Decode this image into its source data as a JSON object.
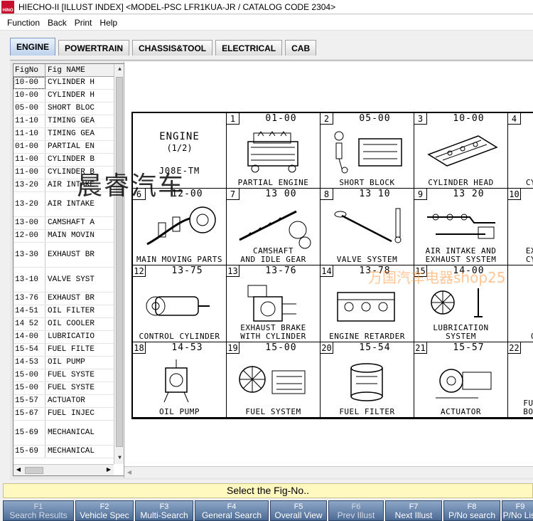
{
  "title_bar": {
    "logo_text": "HINO",
    "title": "HIECHO-II [ILLUST INDEX] <MODEL-PSC LFR1KUA-JR  / CATALOG CODE  2304>"
  },
  "menu": [
    "Function",
    "Back",
    "Print",
    "Help"
  ],
  "tabs": [
    {
      "label": "ENGINE",
      "active": true
    },
    {
      "label": "POWERTRAIN",
      "active": false
    },
    {
      "label": "CHASSIS&TOOL",
      "active": false
    },
    {
      "label": "ELECTRICAL",
      "active": false
    },
    {
      "label": "CAB",
      "active": false
    }
  ],
  "fig_list": {
    "headers": [
      "FigNo",
      "Fig NAME"
    ],
    "rows": [
      {
        "fig": "10-00",
        "name": "CYLINDER H",
        "tall": false
      },
      {
        "fig": "10-00",
        "name": "CYLINDER H",
        "tall": false
      },
      {
        "fig": "05-00",
        "name": "SHORT BLOC",
        "tall": false
      },
      {
        "fig": "11-10",
        "name": "TIMING GEA",
        "tall": false
      },
      {
        "fig": "11-10",
        "name": "TIMING GEA",
        "tall": false
      },
      {
        "fig": "01-00",
        "name": "PARTIAL EN",
        "tall": false
      },
      {
        "fig": "11-00",
        "name": "CYLINDER B",
        "tall": false
      },
      {
        "fig": "11-00",
        "name": "CYLINDER B",
        "tall": false
      },
      {
        "fig": "13-20",
        "name": "AIR INTAKE",
        "tall": false
      },
      {
        "fig": "13-20",
        "name": "AIR INTAKE",
        "tall": true
      },
      {
        "fig": "13-00",
        "name": "CAMSHAFT A",
        "tall": false
      },
      {
        "fig": "12-00",
        "name": "MAIN MOVIN",
        "tall": false
      },
      {
        "fig": "13-30",
        "name": "EXHAUST BR",
        "tall": true
      },
      {
        "fig": "13-10",
        "name": "VALVE SYST",
        "tall": true
      },
      {
        "fig": "13-76",
        "name": "EXHAUST BR",
        "tall": false
      },
      {
        "fig": "14-51",
        "name": "OIL FILTER",
        "tall": false
      },
      {
        "fig": "14 52",
        "name": "OIL COOLER",
        "tall": false
      },
      {
        "fig": "14-00",
        "name": "LUBRICATIO",
        "tall": false
      },
      {
        "fig": "15-54",
        "name": "FUEL FILTE",
        "tall": false
      },
      {
        "fig": "14-53",
        "name": "OIL PUMP",
        "tall": false
      },
      {
        "fig": "15-00",
        "name": "FUEL SYSTE",
        "tall": false
      },
      {
        "fig": "15-00",
        "name": "FUEL SYSTE",
        "tall": false
      },
      {
        "fig": "15-57",
        "name": "ACTUATOR",
        "tall": false
      },
      {
        "fig": "15-67",
        "name": "FUEL INJEC",
        "tall": false
      },
      {
        "fig": "15-69",
        "name": "MECHANICAL",
        "tall": true
      },
      {
        "fig": "15-69",
        "name": "MECHANICAL",
        "tall": false
      }
    ]
  },
  "illust_index": {
    "cover": {
      "title": "ENGINE",
      "subtitle": "(1/2)",
      "code": "J08E-TM"
    },
    "cells": [
      {
        "num": "1",
        "fig": "01-00",
        "name": "PARTIAL ENGINE",
        "pic": "engine"
      },
      {
        "num": "2",
        "fig": "05-00",
        "name": "SHORT BLOCK",
        "pic": "block"
      },
      {
        "num": "3",
        "fig": "10-00",
        "name": "CYLINDER HEAD",
        "pic": "head"
      },
      {
        "num": "4",
        "fig": "",
        "name": "CYL",
        "pic": "none"
      },
      {
        "num": "6",
        "fig": "12-00",
        "name": "MAIN MOVING PARTS",
        "pic": "crank"
      },
      {
        "num": "7",
        "fig": "13 00",
        "name": "CAMSHAFT\nAND IDLE GEAR",
        "pic": "cam"
      },
      {
        "num": "8",
        "fig": "13 10",
        "name": "VALVE SYSTEM",
        "pic": "valve"
      },
      {
        "num": "9",
        "fig": "13 20",
        "name": "AIR INTAKE AND\nEXHAUST SYSTEM",
        "pic": "manifold"
      },
      {
        "num": "10",
        "fig": "",
        "name": "EXH\nCYL",
        "pic": "none"
      },
      {
        "num": "12",
        "fig": "13-75",
        "name": "CONTROL CYLINDER",
        "pic": "cylinder"
      },
      {
        "num": "13",
        "fig": "13-76",
        "name": "EXHAUST BRAKE\nWITH CYLINDER",
        "pic": "brake"
      },
      {
        "num": "14",
        "fig": "13-78",
        "name": "ENGINE RETARDER",
        "pic": "retarder"
      },
      {
        "num": "15",
        "fig": "14-00",
        "name": "LUBRICATION\nSYSTEM",
        "pic": "lube"
      },
      {
        "num": "",
        "fig": "",
        "name": "O",
        "pic": "none"
      },
      {
        "num": "18",
        "fig": "14-53",
        "name": "OIL PUMP",
        "pic": "pump"
      },
      {
        "num": "19",
        "fig": "15-00",
        "name": "FUEL SYSTEM",
        "pic": "fuel"
      },
      {
        "num": "20",
        "fig": "15-54",
        "name": "FUEL FILTER",
        "pic": "filter"
      },
      {
        "num": "21",
        "fig": "15-57",
        "name": "ACTUATOR",
        "pic": "actuator"
      },
      {
        "num": "22",
        "fig": "",
        "name": "FUEL\nBODY",
        "pic": "none"
      }
    ]
  },
  "watermarks": {
    "primary": "晨睿汽车",
    "secondary": "万国汽车电器shop25"
  },
  "status": "Select the Fig-No..",
  "function_keys": [
    {
      "key": "F1",
      "label": "Search Results",
      "disabled": true
    },
    {
      "key": "F2",
      "label": "Vehicle Spec",
      "disabled": false
    },
    {
      "key": "F3",
      "label": "Multi-Search",
      "disabled": false
    },
    {
      "key": "F4",
      "label": "General Search",
      "disabled": false
    },
    {
      "key": "F5",
      "label": "Overall View",
      "disabled": false
    },
    {
      "key": "F6",
      "label": "Prev Illust",
      "disabled": true
    },
    {
      "key": "F7",
      "label": "Next Illust",
      "disabled": false
    },
    {
      "key": "F8",
      "label": "P/No search",
      "disabled": false
    },
    {
      "key": "F9",
      "label": "P/No List",
      "disabled": false
    }
  ],
  "colors": {
    "status_bg": "#fff8bf",
    "fkey_top": "#8ea7c7",
    "fkey_bottom": "#4d6b95",
    "tab_active": "#bcd2ec",
    "hino_red": "#c8102e"
  }
}
